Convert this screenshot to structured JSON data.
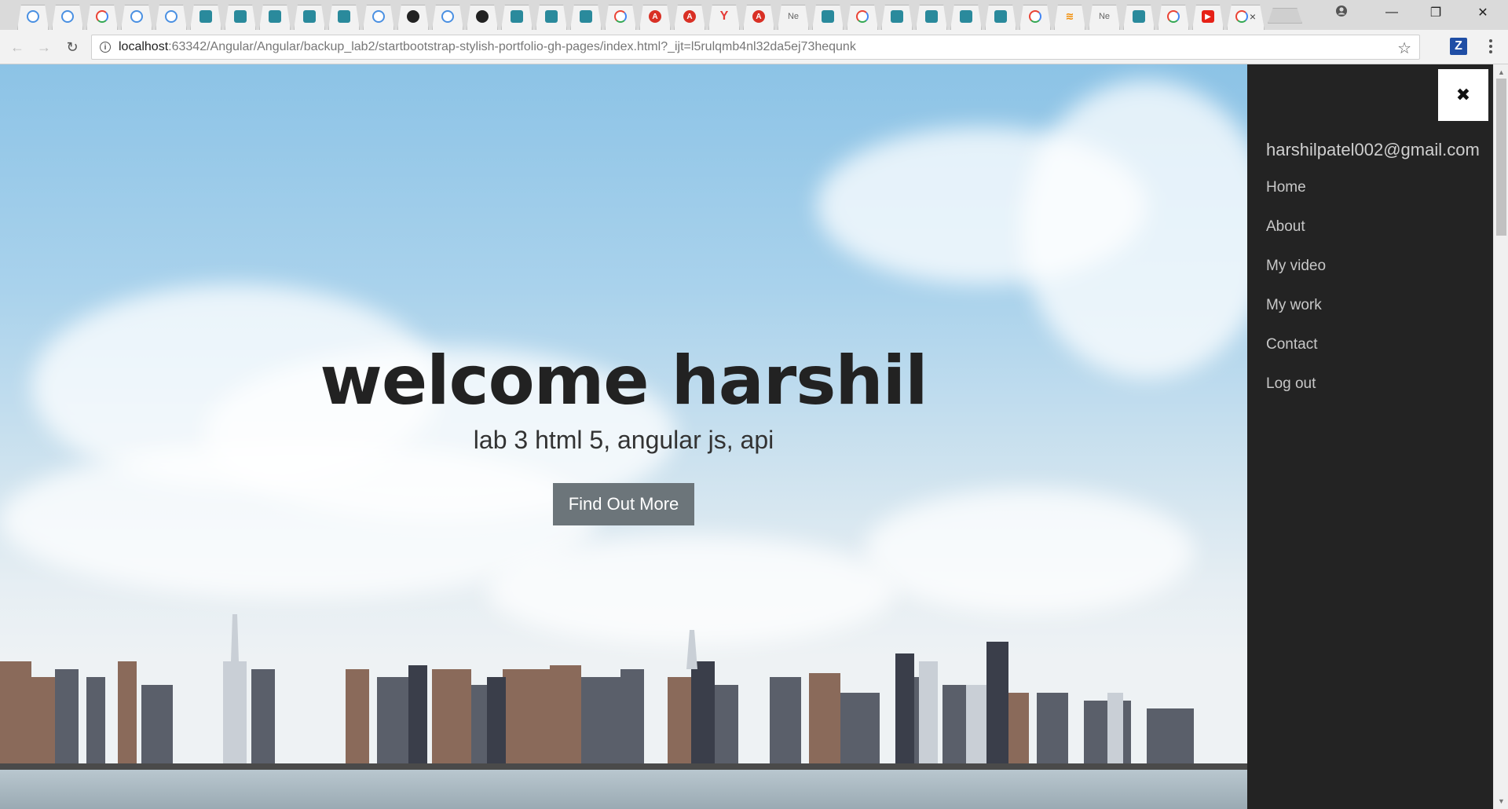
{
  "browser": {
    "tabs": [
      {
        "icon": "chrome-icon"
      },
      {
        "icon": "chrome-icon"
      },
      {
        "icon": "google-icon"
      },
      {
        "icon": "chrome-icon"
      },
      {
        "icon": "chrome-icon"
      },
      {
        "icon": "camera-icon"
      },
      {
        "icon": "camera-icon"
      },
      {
        "icon": "camera-icon"
      },
      {
        "icon": "camera-icon"
      },
      {
        "icon": "camera-icon"
      },
      {
        "icon": "chrome-icon"
      },
      {
        "icon": "github-icon"
      },
      {
        "icon": "chrome-icon"
      },
      {
        "icon": "github-icon"
      },
      {
        "icon": "camera-icon"
      },
      {
        "icon": "camera-icon"
      },
      {
        "icon": "camera-icon"
      },
      {
        "icon": "google-icon"
      },
      {
        "icon": "angular-icon"
      },
      {
        "icon": "angular-icon"
      },
      {
        "icon": "y-icon",
        "glyph": "Y"
      },
      {
        "icon": "angular-icon"
      },
      {
        "icon": "text-icon",
        "glyph": "Ne"
      },
      {
        "icon": "camera-icon"
      },
      {
        "icon": "google-icon"
      },
      {
        "icon": "camera-icon"
      },
      {
        "icon": "camera-icon"
      },
      {
        "icon": "camera-icon"
      },
      {
        "icon": "camera-icon"
      },
      {
        "icon": "google-icon"
      },
      {
        "icon": "stackoverflow-icon"
      },
      {
        "icon": "text-icon",
        "glyph": "Ne"
      },
      {
        "icon": "camera-icon"
      },
      {
        "icon": "google-icon"
      },
      {
        "icon": "youtube-icon"
      },
      {
        "icon": "google-icon",
        "active": true
      }
    ],
    "active_tab_close": "×",
    "window_controls": {
      "minimize": "—",
      "maximize": "❐",
      "close": "✕"
    },
    "url_host": "localhost",
    "url_rest": ":63342/Angular/Angular/backup_lab2/startbootstrap-stylish-portfolio-gh-pages/index.html?_ijt=l5rulqmb4nl32da5ej73hequnk",
    "extension_label": "Z"
  },
  "hero": {
    "title": "welcome harshil",
    "subtitle": "lab 3 html 5, angular js, api",
    "button_label": "Find Out More"
  },
  "sidebar": {
    "close_glyph": "✖",
    "email": "harshilpatel002@gmail.com",
    "items": [
      {
        "label": "Home"
      },
      {
        "label": "About"
      },
      {
        "label": "My video"
      },
      {
        "label": "My work"
      },
      {
        "label": "Contact"
      },
      {
        "label": "Log out"
      }
    ]
  }
}
